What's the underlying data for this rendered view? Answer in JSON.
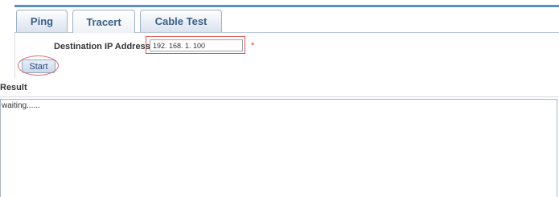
{
  "tabs": [
    {
      "label": "Ping",
      "active": false
    },
    {
      "label": "Tracert",
      "active": true
    },
    {
      "label": "Cable Test",
      "active": false
    }
  ],
  "form": {
    "destination_label": "Destination IP Address:",
    "destination_value": "192. 168. 1. 100",
    "required_mark": "*",
    "start_label": "Start"
  },
  "result": {
    "label": "Result",
    "output": "waiting......"
  },
  "colors": {
    "accent": "#5a8fc8",
    "tab_text": "#3a5f8a",
    "highlight": "#d9534f",
    "required": "#e53935"
  }
}
